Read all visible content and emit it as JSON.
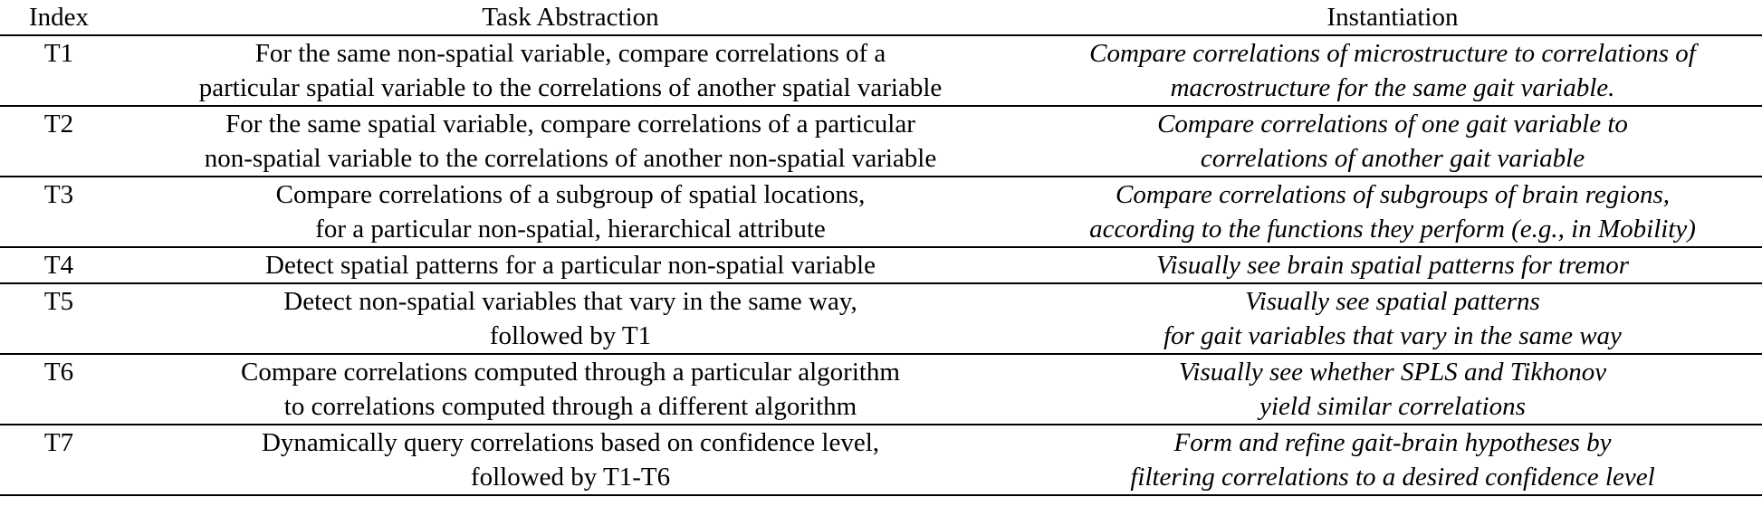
{
  "table": {
    "headers": {
      "index": "Index",
      "task": "Task Abstraction",
      "instantiation": "Instantiation"
    },
    "rows": [
      {
        "index": "T1",
        "task": [
          "For the same non-spatial variable, compare correlations of a",
          "particular spatial variable to the correlations of another spatial variable"
        ],
        "instantiation": [
          "Compare correlations of microstructure to correlations of",
          "macrostructure for the same gait variable."
        ]
      },
      {
        "index": "T2",
        "task": [
          "For the same spatial variable, compare correlations of a particular",
          "non-spatial variable to the correlations of another non-spatial variable"
        ],
        "instantiation": [
          "Compare correlations of one gait variable to",
          "correlations of another gait variable"
        ]
      },
      {
        "index": "T3",
        "task": [
          "Compare correlations of a subgroup of spatial locations,",
          "for a particular non-spatial, hierarchical attribute"
        ],
        "instantiation": [
          "Compare correlations of subgroups of brain regions,",
          "according to the functions they perform (e.g., in Mobility)"
        ]
      },
      {
        "index": "T4",
        "task": [
          "Detect spatial patterns for a particular non-spatial variable"
        ],
        "instantiation": [
          "Visually see brain spatial patterns for tremor"
        ]
      },
      {
        "index": "T5",
        "task": [
          "Detect non-spatial variables that vary in the same way,",
          "followed by T1"
        ],
        "instantiation": [
          "Visually see spatial patterns",
          "for gait variables that vary in the same way"
        ]
      },
      {
        "index": "T6",
        "task": [
          "Compare correlations computed through a particular algorithm",
          "to correlations computed through a different algorithm"
        ],
        "instantiation": [
          "Visually see whether SPLS and Tikhonov",
          "yield similar correlations"
        ]
      },
      {
        "index": "T7",
        "task": [
          "Dynamically query correlations based on confidence level,",
          "followed by T1-T6"
        ],
        "instantiation": [
          "Form and refine gait-brain hypotheses by",
          "filtering correlations to a desired confidence level"
        ]
      }
    ]
  }
}
